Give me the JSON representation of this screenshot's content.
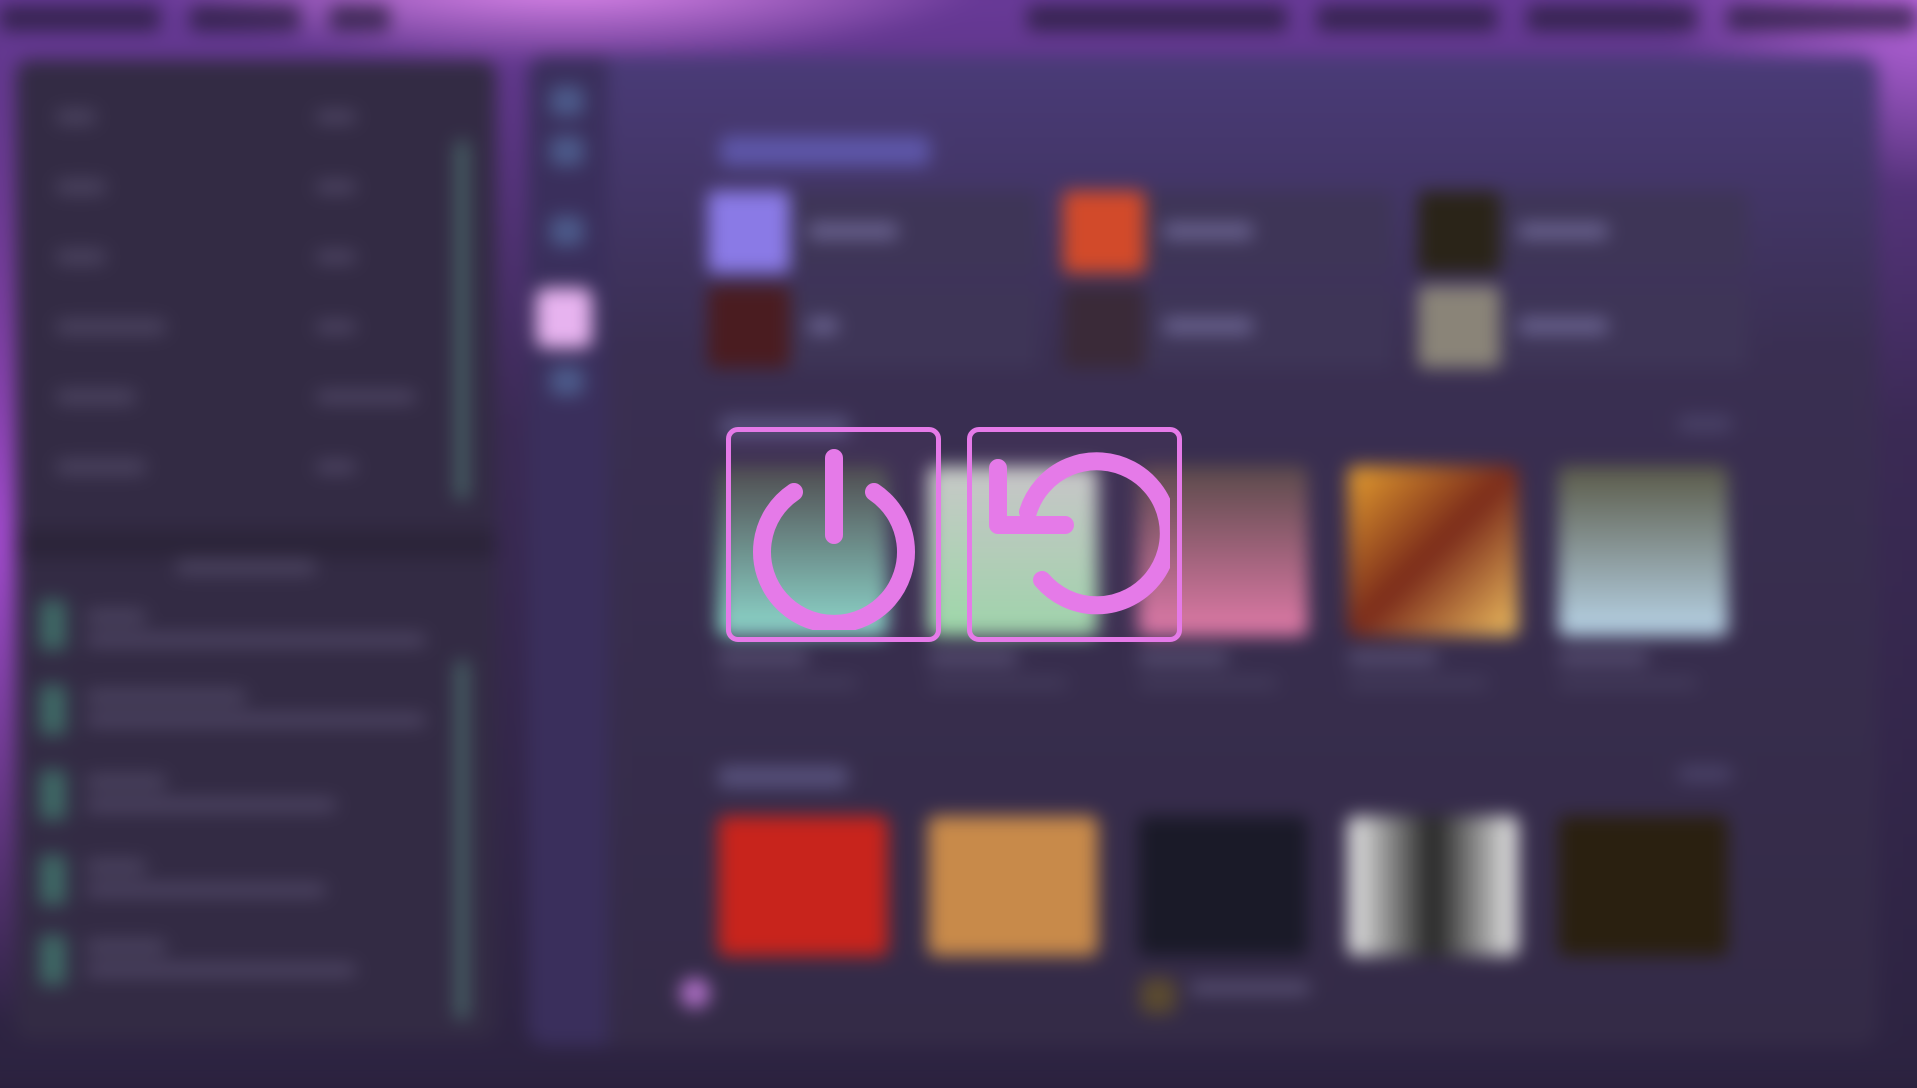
{
  "overlay": {
    "accent_color": "#e57ae8",
    "buttons": [
      {
        "id": "shutdown",
        "icon": "power-icon",
        "label": ""
      },
      {
        "id": "restart",
        "icon": "restart-icon",
        "label": ""
      }
    ]
  },
  "background": {
    "blurred": true,
    "apps": [
      "music-player-window",
      "sidebar-panel"
    ]
  }
}
